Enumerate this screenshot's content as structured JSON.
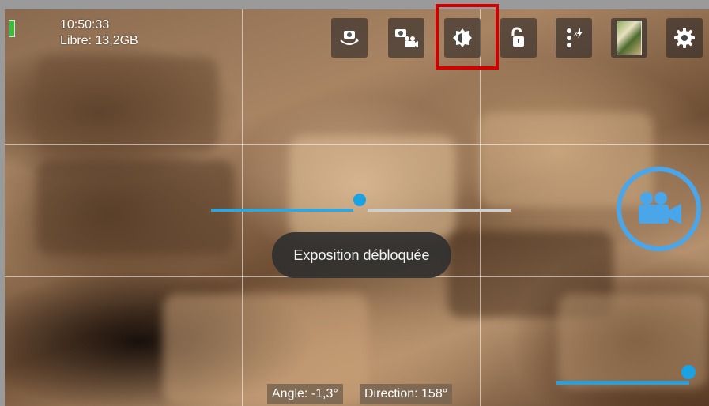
{
  "status": {
    "time": "10:50:33",
    "free_space": "Libre: 13,2GB"
  },
  "toolbar": {
    "items": [
      {
        "name": "switch-camera-icon"
      },
      {
        "name": "photo-video-mode-icon"
      },
      {
        "name": "exposure-lock-icon"
      },
      {
        "name": "unlock-icon"
      },
      {
        "name": "flash-options-icon"
      },
      {
        "name": "gallery-thumbnail"
      },
      {
        "name": "settings-icon"
      }
    ]
  },
  "exposure": {
    "level": 0.5
  },
  "toast": {
    "text": "Exposition débloquée"
  },
  "zoom": {
    "level": 1.0
  },
  "readouts": {
    "angle": "Angle: -1,3°",
    "direction": "Direction: 158°"
  },
  "colors": {
    "accent": "#1ba2e3",
    "highlight": "#d40000",
    "record_ring": "#4aa6e8"
  }
}
